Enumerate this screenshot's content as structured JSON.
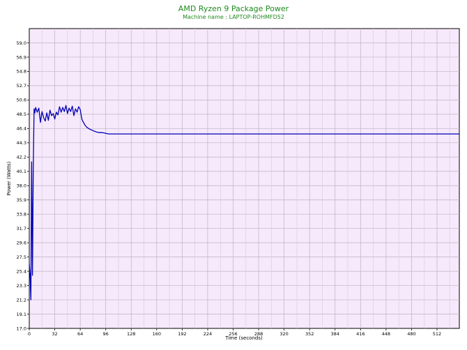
{
  "chart_data": {
    "type": "line",
    "title": "AMD Ryzen 9 Package Power",
    "subtitle": "Machine name : LAPTOP-ROHMFD52",
    "xlabel": "Time (seconds)",
    "ylabel": "Power (Watts)",
    "xlim": [
      0,
      540
    ],
    "ylim": [
      17.0,
      61.1
    ],
    "x_ticks": [
      "0",
      "32",
      "64",
      "96",
      "128",
      "160",
      "192",
      "224",
      "256",
      "288",
      "320",
      "352",
      "384",
      "416",
      "448",
      "480",
      "512"
    ],
    "y_ticks": [
      "17.0",
      "19.1",
      "21.2",
      "23.3",
      "25.4",
      "27.5",
      "29.6",
      "31.7",
      "33.8",
      "35.9",
      "38.0",
      "40.1",
      "42.2",
      "44.3",
      "46.4",
      "48.5",
      "50.6",
      "52.7",
      "54.8",
      "56.9",
      "59.0"
    ],
    "grid": true,
    "series": [
      {
        "color": "#0000b4",
        "x": [
          0,
          1,
          2,
          3,
          4,
          5,
          6,
          7,
          8,
          10,
          12,
          14,
          16,
          18,
          20,
          22,
          24,
          26,
          28,
          30,
          32,
          34,
          36,
          38,
          40,
          42,
          44,
          46,
          48,
          50,
          52,
          54,
          56,
          58,
          60,
          62,
          64,
          66,
          68,
          70,
          72,
          76,
          80,
          84,
          88,
          92,
          96,
          100,
          110,
          120,
          130,
          140,
          160,
          180,
          200,
          220,
          240,
          260,
          280,
          300,
          320,
          340,
          360,
          380,
          400,
          420,
          440,
          460,
          480,
          500,
          520,
          540
        ],
        "y": [
          26.5,
          25.0,
          21.2,
          41.5,
          24.8,
          40.2,
          49.3,
          48.7,
          49.5,
          48.8,
          49.4,
          47.3,
          48.9,
          48.0,
          47.5,
          48.7,
          47.6,
          49.1,
          48.3,
          48.6,
          47.8,
          48.8,
          48.4,
          49.6,
          48.8,
          49.5,
          48.9,
          49.8,
          48.6,
          49.4,
          48.9,
          49.7,
          48.3,
          49.3,
          48.8,
          49.6,
          49.2,
          47.8,
          47.3,
          46.9,
          46.6,
          46.3,
          46.1,
          45.9,
          45.8,
          45.8,
          45.7,
          45.6,
          45.6,
          45.6,
          45.6,
          45.6,
          45.6,
          45.6,
          45.6,
          45.6,
          45.6,
          45.6,
          45.6,
          45.6,
          45.6,
          45.6,
          45.6,
          45.6,
          45.6,
          45.6,
          45.6,
          45.6,
          45.6,
          45.6,
          45.6,
          45.6
        ]
      }
    ]
  }
}
